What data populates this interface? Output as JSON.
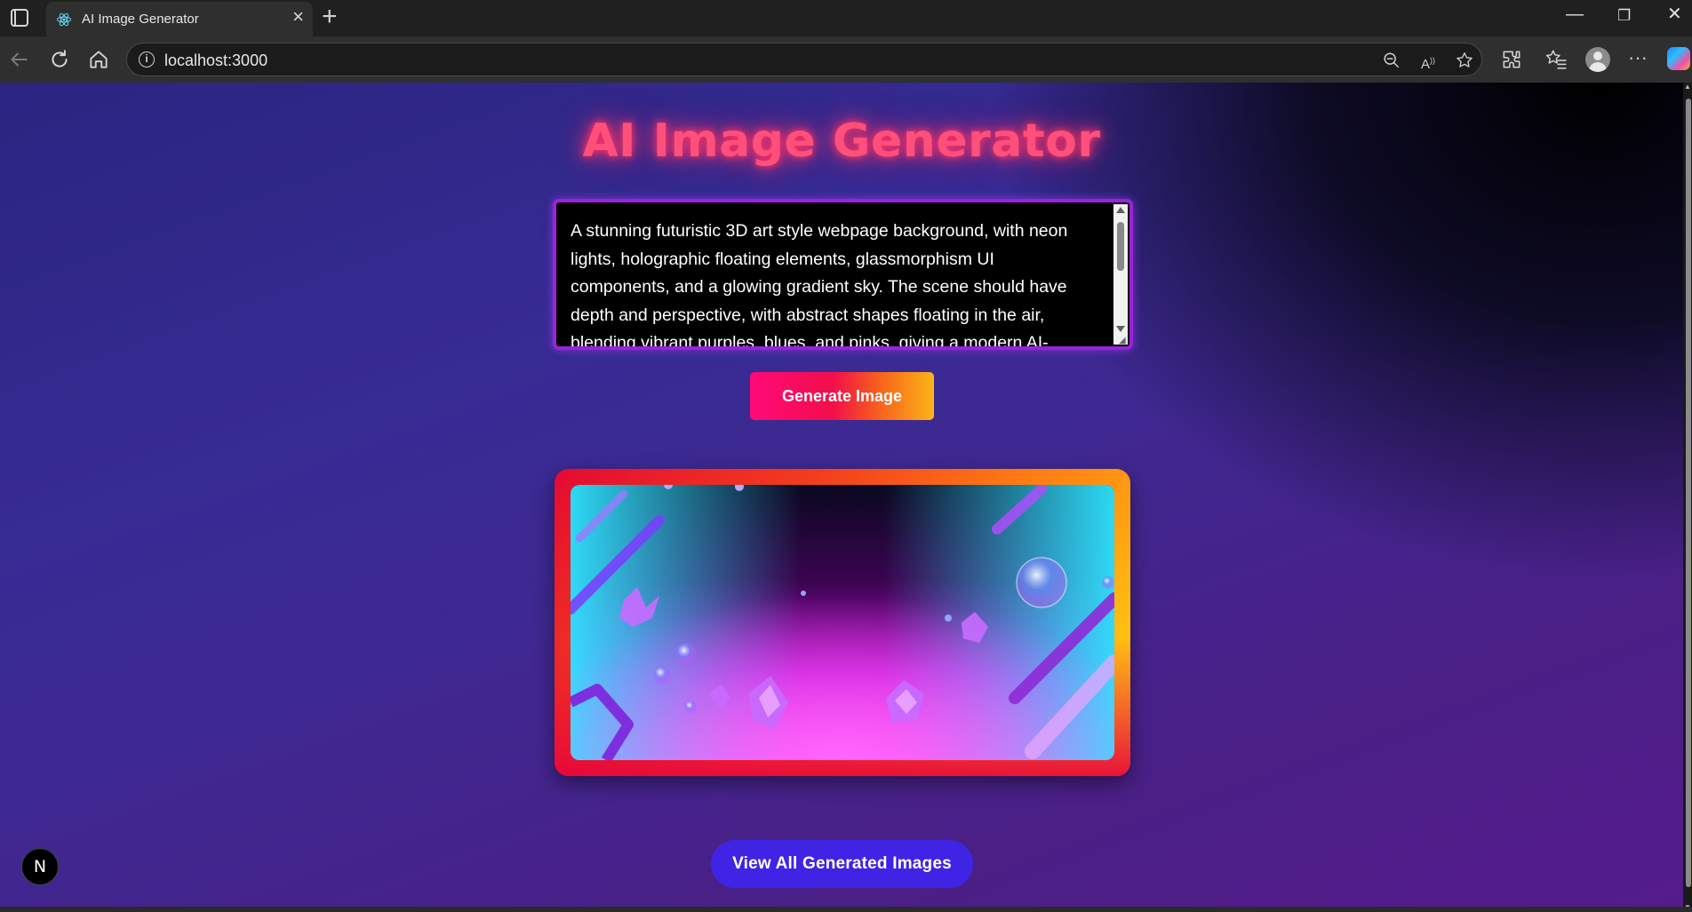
{
  "browser": {
    "tab_title": "AI Image Generator",
    "tab_close": "×",
    "new_tab": "+",
    "url": "localhost:3000",
    "window_controls": {
      "minimize": "—",
      "restore": "❐",
      "close": "✕"
    },
    "toolbar_icons": [
      "back-icon",
      "refresh-icon",
      "home-icon",
      "info-icon",
      "zoom-out-icon",
      "read-aloud-icon",
      "favorite-icon",
      "extensions-icon",
      "favorites-list-icon",
      "profile-icon",
      "more-icon",
      "copilot-icon"
    ]
  },
  "page": {
    "title": "AI Image Generator",
    "prompt_text": "A stunning futuristic 3D art style webpage background, with neon lights, holographic floating elements, glassmorphism UI components, and a glowing gradient sky. The scene should have depth and perspective, with abstract shapes floating in the air, blending vibrant purples, blues, and pinks, giving a modern AI-generated aesthetic.",
    "generate_button": "Generate Image",
    "view_all_button": "View All Generated Images",
    "dev_badge": "N"
  },
  "colors": {
    "title": "#ff4f7b",
    "prompt_border": "#9b22d8",
    "view_all_button": "#3f24e6",
    "generate_gradient": [
      "#ff0a78",
      "#f20e4a",
      "#f7611c",
      "#fdb418"
    ]
  }
}
